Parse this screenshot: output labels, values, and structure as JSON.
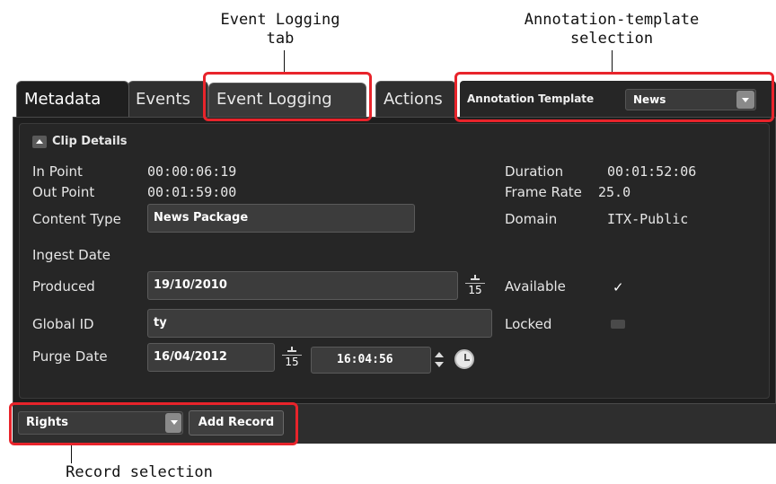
{
  "callouts": {
    "event_logging_line1": "Event Logging",
    "event_logging_line2": "tab",
    "annotation_line1": "Annotation-template",
    "annotation_line2": "selection",
    "record": "Record selection"
  },
  "tabs": [
    {
      "label": "Metadata",
      "active": true
    },
    {
      "label": "Events",
      "active": false
    },
    {
      "label": "Event Logging",
      "active": false
    },
    {
      "label": "Actions",
      "active": false
    }
  ],
  "annotation": {
    "label": "Annotation Template",
    "value": "News",
    "dropdown_icon": "chevron-down-icon"
  },
  "clip_details": {
    "section_title": "Clip Details",
    "in_point_label": "In Point",
    "in_point_value": "00:00:06:19",
    "out_point_label": "Out Point",
    "out_point_value": "00:01:59:00",
    "content_type_label": "Content Type",
    "content_type_value": "News Package",
    "duration_label": "Duration",
    "duration_value": "00:01:52:06",
    "frame_rate_label": "Frame Rate",
    "frame_rate_value": "25.0",
    "domain_label": "Domain",
    "domain_value": "ITX-Public",
    "ingest_date_label": "Ingest Date",
    "produced_label": "Produced",
    "produced_value": "19/10/2010",
    "available_label": "Available",
    "available_checked": true,
    "global_id_label": "Global ID",
    "global_id_value": "ty",
    "locked_label": "Locked",
    "locked_checked": false,
    "purge_date_label": "Purge Date",
    "purge_date_value": "16/04/2012",
    "purge_time_value": "16:04:56",
    "calendar_day": "15"
  },
  "footer": {
    "record_value": "Rights",
    "add_record_label": "Add Record"
  },
  "colors": {
    "highlight": "#e8242b",
    "panel_bg": "#1e1e1e",
    "input_bg": "#3c3c3c"
  }
}
